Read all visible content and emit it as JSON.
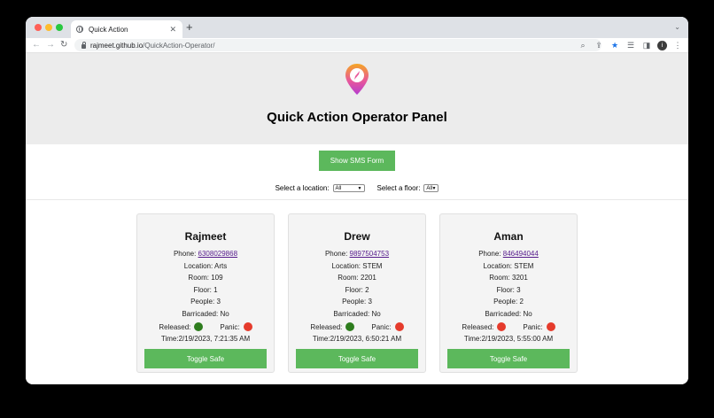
{
  "browser": {
    "tab_title": "Quick Action",
    "url_host": "rajmeet.github.io",
    "url_path": "/QuickAction-Operator/",
    "avatar_letter": "i"
  },
  "page": {
    "title": "Quick Action Operator Panel",
    "sms_button": "Show SMS Form",
    "location_label": "Select a location:",
    "location_value": "All",
    "floor_label": "Select a floor:",
    "floor_value": "All"
  },
  "labels": {
    "phone": "Phone: ",
    "location": "Location: ",
    "room": "Room: ",
    "floor": "Floor: ",
    "people": "People: ",
    "barricaded": "Barricaded: ",
    "released": "Released:",
    "panic": "Panic:",
    "time": "Time:",
    "toggle": "Toggle Safe"
  },
  "colors": {
    "green": "#2e7d1e",
    "red": "#e53b2c",
    "button": "#5cb85c"
  },
  "cards": [
    {
      "name": "Rajmeet",
      "phone": "6308029868",
      "location": "Arts",
      "room": "109",
      "floor": "1",
      "people": "3",
      "barricaded": "No",
      "released": "green",
      "panic": "red",
      "time": "2/19/2023, 7:21:35 AM"
    },
    {
      "name": "Drew",
      "phone": "9897504753",
      "location": "STEM",
      "room": "2201",
      "floor": "2",
      "people": "3",
      "barricaded": "No",
      "released": "green",
      "panic": "red",
      "time": "2/19/2023, 6:50:21 AM"
    },
    {
      "name": "Aman",
      "phone": "846494044",
      "location": "STEM",
      "room": "3201",
      "floor": "3",
      "people": "2",
      "barricaded": "No",
      "released": "red",
      "panic": "red",
      "time": "2/19/2023, 5:55:00 AM"
    }
  ]
}
